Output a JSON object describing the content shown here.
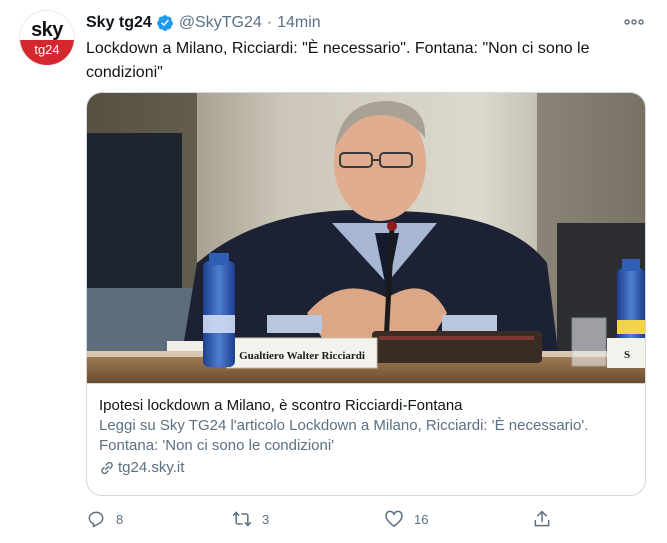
{
  "tweet": {
    "avatar": {
      "logo_text": "sky",
      "badge_text": "tg24"
    },
    "author_name": "Sky tg24",
    "handle": "@SkyTG24",
    "separator": "·",
    "time": "14min",
    "text": "Lockdown a Milano, Ricciardi: \"È necessario\". Fontana: \"Non ci sono le condizioni\""
  },
  "card": {
    "image": {
      "nameplate": "Gualtiero Walter Ricciardi",
      "bottle_label": "S"
    },
    "title": "Ipotesi lockdown a Milano, è scontro Ricciardi-Fontana",
    "description": "Leggi su Sky TG24 l'articolo Lockdown a Milano, Ricciardi: 'È necessario'. Fontana: 'Non ci sono le condizioni'",
    "domain": "tg24.sky.it"
  },
  "actions": {
    "replies": "8",
    "retweets": "3",
    "likes": "16"
  },
  "colors": {
    "accent": "#1d9bf0",
    "brand_red": "#d4272f",
    "muted": "#5b7083",
    "border": "#cfd9de"
  },
  "icons": [
    "verified-badge-icon",
    "more-icon",
    "link-icon",
    "reply-icon",
    "retweet-icon",
    "like-icon",
    "share-icon"
  ]
}
